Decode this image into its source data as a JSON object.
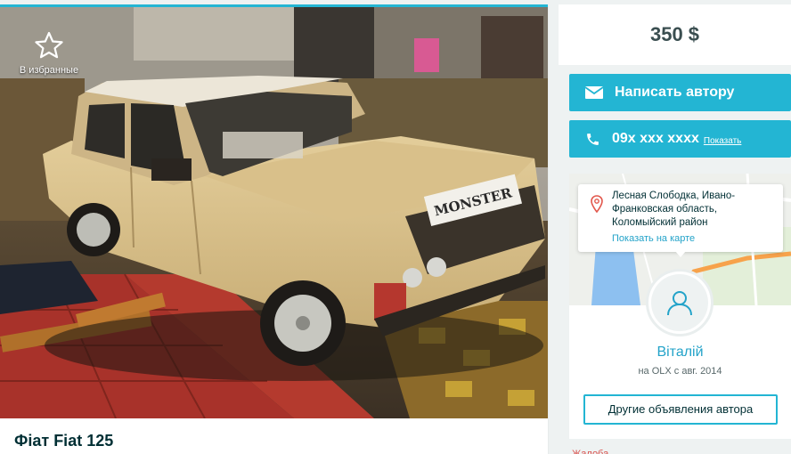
{
  "listing": {
    "title": "Фіат Fiat 125",
    "favorite_label": "В избранные",
    "photo_plate_text": "MONSTER"
  },
  "price": "350 $",
  "actions": {
    "message_label": "Написать автору",
    "phone_number": "09x xxx xxxx",
    "phone_show_label": "Показать"
  },
  "location": {
    "address": "Лесная Слободка, Ивано-Франковская область, Коломыйский район",
    "map_link": "Показать на карте"
  },
  "seller": {
    "name": "Віталій",
    "since": "на OLX с авг. 2014",
    "other_ads_label": "Другие объявления автора"
  },
  "footer": {
    "complaint_label": "Жалоба"
  },
  "colors": {
    "accent": "#23b5d3",
    "link": "#23a3c9",
    "text": "#002f34",
    "background": "#eef2f2"
  }
}
